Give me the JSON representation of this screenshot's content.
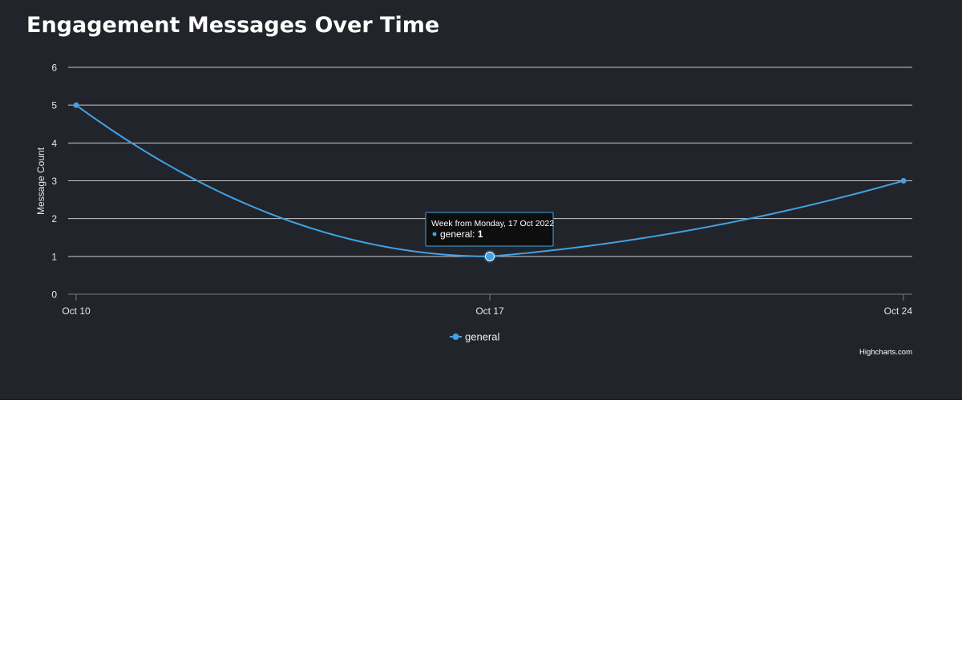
{
  "page": {
    "title": "Engagement Messages Over Time"
  },
  "chart_data": {
    "type": "line",
    "title": "Engagement Messages Over Time",
    "xlabel": "",
    "ylabel": "Message Count",
    "categories": [
      "Oct 10",
      "Oct 17",
      "Oct 24"
    ],
    "x": [
      "2022-10-10",
      "2022-10-17",
      "2022-10-24"
    ],
    "series": [
      {
        "name": "general",
        "values": [
          5,
          1,
          3
        ],
        "color": "#41a2e5"
      }
    ],
    "ylim": [
      0,
      6
    ],
    "yticks": [
      0,
      1,
      2,
      3,
      4,
      5,
      6
    ],
    "grid": true,
    "legend": "bottom-center",
    "line_style": "spline"
  },
  "tooltip": {
    "header": "Week from Monday, 17 Oct 2022",
    "series_name": "general",
    "value": "1"
  },
  "credits": "Highcharts.com",
  "colors": {
    "background": "#22242b",
    "grid": "#c8c8c8",
    "series": "#41a2e5",
    "tooltip_bg": "#0e0e0e",
    "tooltip_border": "#41a2e5"
  }
}
